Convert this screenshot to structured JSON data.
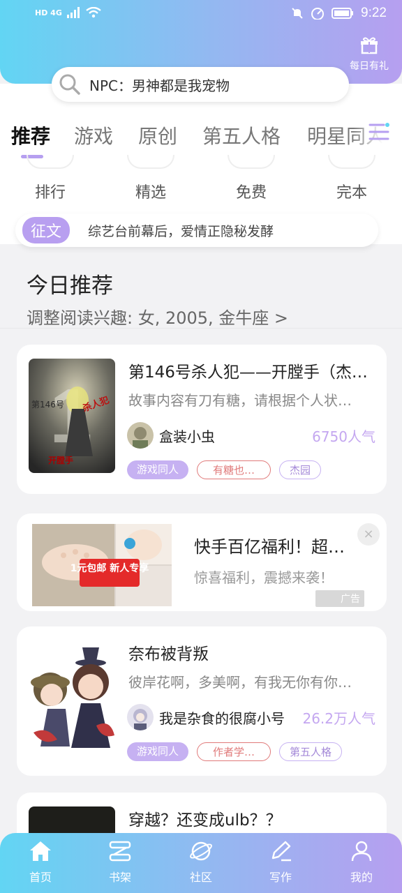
{
  "status_bar": {
    "network": "HD 4G",
    "time": "9:22"
  },
  "header": {
    "gift_label": "每日有礼",
    "search_text": "NPC：男神都是我宠物"
  },
  "tabs": [
    "推荐",
    "游戏",
    "原创",
    "第五人格",
    "明星同人"
  ],
  "categories": [
    "排行",
    "精选",
    "免费",
    "完本"
  ],
  "notice": {
    "tag": "征文",
    "text": "综艺台前幕后，爱情正隐秘发酵"
  },
  "section": {
    "title": "今日推荐",
    "subtitle": "调整阅读兴趣: 女, 2005, 金牛座 >"
  },
  "books": [
    {
      "title": "第146号杀人犯——开膛手（杰…",
      "desc": "故事内容有刀有糖，请根据个人状…",
      "author": "盒装小虫",
      "popularity": "6750人气",
      "tags": [
        "游戏同人",
        "有糖也…",
        "杰园"
      ],
      "cover_text": [
        "1",
        "第146号",
        "杀人犯",
        "开膛手"
      ]
    },
    {
      "title": "奈布被背叛",
      "desc": "彼岸花啊，多美啊，有我无你有你…",
      "author": "我是杂食的很腐小号",
      "popularity": "26.2万人气",
      "tags": [
        "游戏同人",
        "作者学…",
        "第五人格"
      ]
    },
    {
      "title": "穿越？还变成ulb？？"
    }
  ],
  "ad": {
    "title": "快手百亿福利！超…",
    "desc": "惊喜福利，震撼来袭！",
    "badge": "广告",
    "image_text": "1元包邮 新人专享",
    "close": "×"
  },
  "bottom_nav": [
    "首页",
    "书架",
    "社区",
    "写作",
    "我的"
  ],
  "colors": {
    "accent": "#b69ff0",
    "gradient_start": "#62d5f3",
    "gradient_end": "#b69ff0",
    "popularity": "#c4a7f0"
  }
}
